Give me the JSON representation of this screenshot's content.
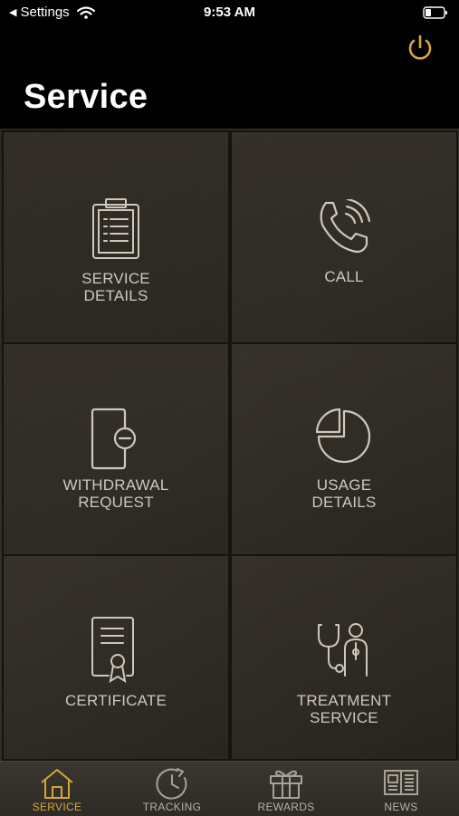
{
  "status_bar": {
    "back_label": "Settings",
    "time": "9:53 AM"
  },
  "header": {
    "title": "Service"
  },
  "tiles": [
    {
      "label": "SERVICE\nDETAILS",
      "icon": "clipboard-icon"
    },
    {
      "label": "CALL",
      "icon": "phone-icon"
    },
    {
      "label": "WITHDRAWAL\nREQUEST",
      "icon": "door-minus-icon"
    },
    {
      "label": "USAGE\nDETAILS",
      "icon": "pie-chart-icon"
    },
    {
      "label": "CERTIFICATE",
      "icon": "certificate-icon"
    },
    {
      "label": "TREATMENT\nSERVICE",
      "icon": "stethoscope-icon"
    }
  ],
  "tabs": [
    {
      "label": "SERVICE",
      "icon": "home-icon",
      "active": true
    },
    {
      "label": "TRACKING",
      "icon": "clock-icon",
      "active": false
    },
    {
      "label": "REWARDS",
      "icon": "gift-icon",
      "active": false
    },
    {
      "label": "NEWS",
      "icon": "newspaper-icon",
      "active": false
    }
  ],
  "colors": {
    "accent": "#d8a53a",
    "tile_text": "#cfc8bb",
    "icon_stroke": "#cfc8bb"
  }
}
